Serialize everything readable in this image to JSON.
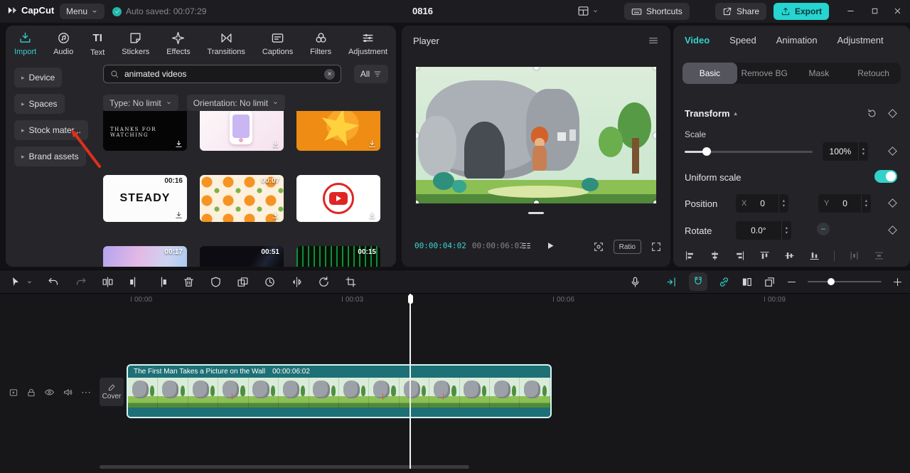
{
  "colors": {
    "accent": "#33d1cc",
    "export_bg": "#26d4d0",
    "annotation": "#df301b",
    "clip_teal": "#1d7076"
  },
  "icons": {
    "autosave_check": "✓",
    "clear_search": "×",
    "more": "⋯",
    "stepper_up": "▴",
    "stepper_down": "▾",
    "sidebar_caret": "▸",
    "caret_up": "▴"
  },
  "topbar": {
    "app_name": "CapCut",
    "menu": "Menu",
    "autosave": "Auto saved: 00:07:29",
    "title": "0816",
    "shortcuts": "Shortcuts",
    "share": "Share",
    "export": "Export"
  },
  "media": {
    "tabs": [
      {
        "label": "Import"
      },
      {
        "label": "Audio"
      },
      {
        "label": "Text",
        "glyph": "TI"
      },
      {
        "label": "Stickers"
      },
      {
        "label": "Effects"
      },
      {
        "label": "Transitions"
      },
      {
        "label": "Captions"
      },
      {
        "label": "Filters"
      },
      {
        "label": "Adjustment"
      }
    ],
    "sidebar": [
      {
        "label": "Device"
      },
      {
        "label": "Spaces"
      },
      {
        "label": "Stock mater..."
      },
      {
        "label": "Brand assets"
      }
    ],
    "search_value": "animated videos",
    "all_label": "All",
    "type_filter": "Type: No limit",
    "orientation_filter": "Orientation: No limit",
    "thumbs": [
      {
        "caption": "THANKS FOR WATCHING",
        "duration": ""
      },
      {
        "caption": "",
        "duration": ""
      },
      {
        "caption": "",
        "duration": ""
      },
      {
        "caption": "STEADY",
        "duration": "00:16"
      },
      {
        "caption": "",
        "duration": "00:07"
      },
      {
        "caption": "",
        "duration": ""
      },
      {
        "caption": "",
        "duration": "00:17"
      },
      {
        "caption": "",
        "duration": "00:51"
      },
      {
        "caption": "",
        "duration": "00:15"
      }
    ]
  },
  "player": {
    "title": "Player",
    "current": "00:00:04:02",
    "total": "00:00:06:02",
    "ratio": "Ratio"
  },
  "props": {
    "tabs": [
      {
        "label": "Video"
      },
      {
        "label": "Speed"
      },
      {
        "label": "Animation"
      },
      {
        "label": "Adjustment"
      }
    ],
    "subtabs": [
      {
        "label": "Basic"
      },
      {
        "label": "Remove BG"
      },
      {
        "label": "Mask"
      },
      {
        "label": "Retouch"
      }
    ],
    "transform_title": "Transform",
    "scale_label": "Scale",
    "scale_value": "100%",
    "uniform_label": "Uniform scale",
    "position_label": "Position",
    "x_label": "X",
    "x_value": "0",
    "y_label": "Y",
    "y_value": "0",
    "rotate_label": "Rotate",
    "rotate_value": "0.0°"
  },
  "timeline": {
    "ruler": [
      {
        "t": "00:00"
      },
      {
        "t": "00:03"
      },
      {
        "t": "00:06"
      },
      {
        "t": "00:09"
      }
    ],
    "cover": "Cover",
    "clip_title": "The First Man Takes a Picture on the Wall",
    "clip_duration": "00:00:06:02"
  }
}
